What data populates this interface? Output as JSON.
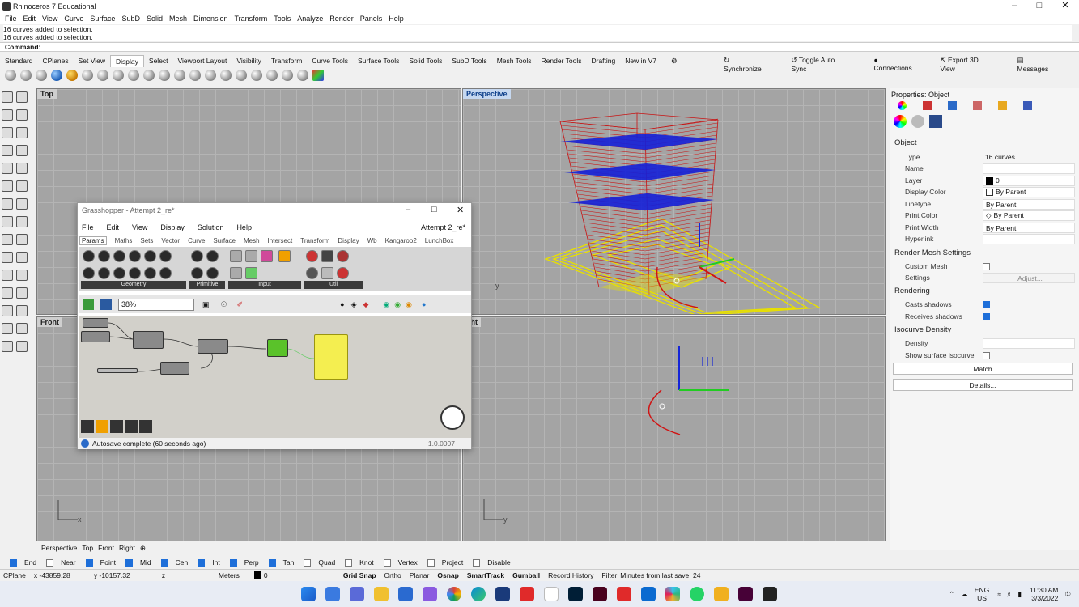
{
  "app": {
    "title": "Rhinoceros 7 Educational"
  },
  "menu": [
    "File",
    "Edit",
    "View",
    "Curve",
    "Surface",
    "SubD",
    "Solid",
    "Mesh",
    "Dimension",
    "Transform",
    "Tools",
    "Analyze",
    "Render",
    "Panels",
    "Help"
  ],
  "command": {
    "history": [
      "16 curves added to selection.",
      "16 curves added to selection."
    ],
    "label": "Command:"
  },
  "toolbar_tabs": [
    "Standard",
    "CPlanes",
    "Set View",
    "Display",
    "Select",
    "Viewport Layout",
    "Visibility",
    "Transform",
    "Curve Tools",
    "Surface Tools",
    "Solid Tools",
    "SubD Tools",
    "Mesh Tools",
    "Render Tools",
    "Drafting",
    "New in V7"
  ],
  "active_toolbar_tab": "Display",
  "right_buttons": [
    "Synchronize",
    "Toggle Auto Sync",
    "Connections",
    "Export 3D View",
    "Messages"
  ],
  "viewports": {
    "top": "Top",
    "perspective": "Perspective",
    "front": "Front",
    "right": "ght"
  },
  "viewport_tabs": [
    "Perspective",
    "Top",
    "Front",
    "Right"
  ],
  "grasshopper": {
    "title": "Grasshopper - Attempt 2_re*",
    "doc": "Attempt 2_re*",
    "menu": [
      "File",
      "Edit",
      "View",
      "Display",
      "Solution",
      "Help"
    ],
    "tabs": [
      "Params",
      "Maths",
      "Sets",
      "Vector",
      "Curve",
      "Surface",
      "Mesh",
      "Intersect",
      "Transform",
      "Display",
      "Wb",
      "Kangaroo2",
      "LunchBox"
    ],
    "groups": [
      "Geometry",
      "Primitive",
      "Input",
      "Util"
    ],
    "zoom": "38%",
    "status": "Autosave complete (60 seconds ago)",
    "version": "1.0.0007"
  },
  "properties": {
    "header": "Properties: Object",
    "section_object": "Object",
    "rows": [
      {
        "k": "Type",
        "v": "16 curves"
      },
      {
        "k": "Name",
        "v": ""
      },
      {
        "k": "Layer",
        "v": "0"
      },
      {
        "k": "Display Color",
        "v": "By Parent"
      },
      {
        "k": "Linetype",
        "v": "By Parent"
      },
      {
        "k": "Print Color",
        "v": "By Parent"
      },
      {
        "k": "Print Width",
        "v": "By Parent"
      },
      {
        "k": "Hyperlink",
        "v": ""
      }
    ],
    "render_mesh": "Render Mesh Settings",
    "custom_mesh": "Custom Mesh",
    "settings": "Settings",
    "adjust": "Adjust...",
    "rendering": "Rendering",
    "casts": "Casts shadows",
    "receives": "Receives shadows",
    "isocurve": "Isocurve Density",
    "density": "Density",
    "show_iso": "Show surface isocurve",
    "match": "Match",
    "details": "Details..."
  },
  "osnaps": [
    {
      "label": "End",
      "on": true
    },
    {
      "label": "Near",
      "on": false
    },
    {
      "label": "Point",
      "on": true
    },
    {
      "label": "Mid",
      "on": true
    },
    {
      "label": "Cen",
      "on": true
    },
    {
      "label": "Int",
      "on": true
    },
    {
      "label": "Perp",
      "on": true
    },
    {
      "label": "Tan",
      "on": true
    },
    {
      "label": "Quad",
      "on": false
    },
    {
      "label": "Knot",
      "on": false
    },
    {
      "label": "Vertex",
      "on": false
    },
    {
      "label": "Project",
      "on": false
    },
    {
      "label": "Disable",
      "on": false
    }
  ],
  "status": {
    "cplane": "CPlane",
    "x": "x -43859.28",
    "y": "y -10157.32",
    "z": "z",
    "units": "Meters",
    "layer": "0",
    "toggles": [
      "Grid Snap",
      "Ortho",
      "Planar",
      "Osnap",
      "SmartTrack",
      "Gumball",
      "Record History",
      "Filter"
    ],
    "save": "Minutes from last save: 24"
  },
  "tray": {
    "lang1": "ENG",
    "lang2": "US",
    "time": "11:30 AM",
    "date": "3/3/2022"
  }
}
